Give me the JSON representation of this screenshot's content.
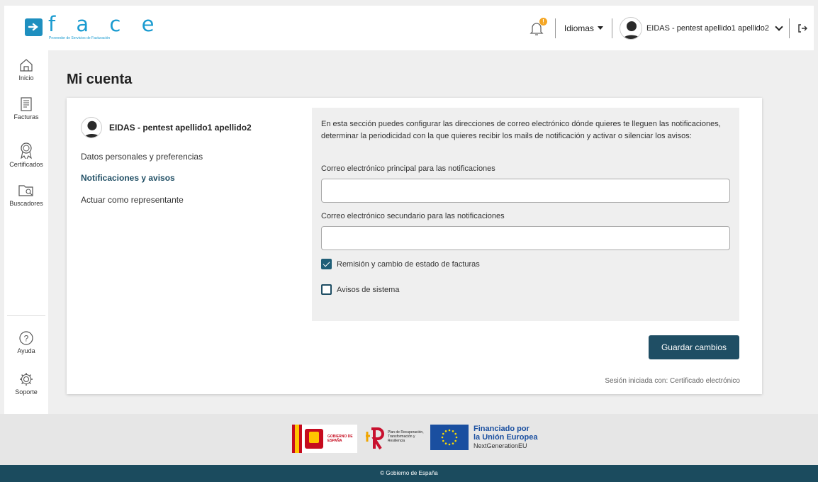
{
  "header": {
    "logo_word": "f a c e",
    "logo_subtitle": "Proveedor de Servicios de Facturación",
    "notification_count": "!",
    "language_label": "Idiomas",
    "user_name": "EIDAS - pentest apellido1 apellido2"
  },
  "sidebar": {
    "items": [
      {
        "label": "Inicio"
      },
      {
        "label": "Facturas"
      },
      {
        "label": "Certificados"
      },
      {
        "label": "Buscadores"
      },
      {
        "label": "Ayuda"
      },
      {
        "label": "Soporte"
      }
    ]
  },
  "page": {
    "title": "Mi cuenta"
  },
  "account": {
    "profile_name": "EIDAS - pentest apellido1 apellido2",
    "menu": [
      {
        "label": "Datos personales y preferencias",
        "active": false
      },
      {
        "label": "Notificaciones y avisos",
        "active": true
      },
      {
        "label": "Actuar como representante",
        "active": false
      }
    ]
  },
  "notifications": {
    "intro": "En esta sección puedes configurar las direcciones de correo electrónico dónde quieres te lleguen las notificaciones, determinar la periodicidad con la que quieres recibir los mails de notificación y activar o silenciar los avisos:",
    "primary_email_label": "Correo electrónico principal para las notificaciones",
    "primary_email_value": "",
    "secondary_email_label": "Correo electrónico secundario para las notificaciones",
    "secondary_email_value": "",
    "checkboxes": [
      {
        "label": "Remisión y cambio de estado de facturas",
        "checked": true
      },
      {
        "label": "Avisos de sistema",
        "checked": false
      }
    ],
    "save_label": "Guardar cambios",
    "session_text": "Sesión iniciada con: Certificado electrónico"
  },
  "footer": {
    "gobierno_label": "GOBIERNO DE ESPAÑA",
    "prtr_label": "Plan de Recuperación, Transformación y Resiliencia",
    "eu_line1": "Financiado por",
    "eu_line2": "la Unión Europea",
    "eu_line3": "NextGenerationEU",
    "copyright": "© Gobierno de España"
  },
  "colors": {
    "brand": "#1a9bd0",
    "primary": "#1f4e64",
    "footer_bar": "#1b4b5e",
    "badge": "#f5a623"
  }
}
